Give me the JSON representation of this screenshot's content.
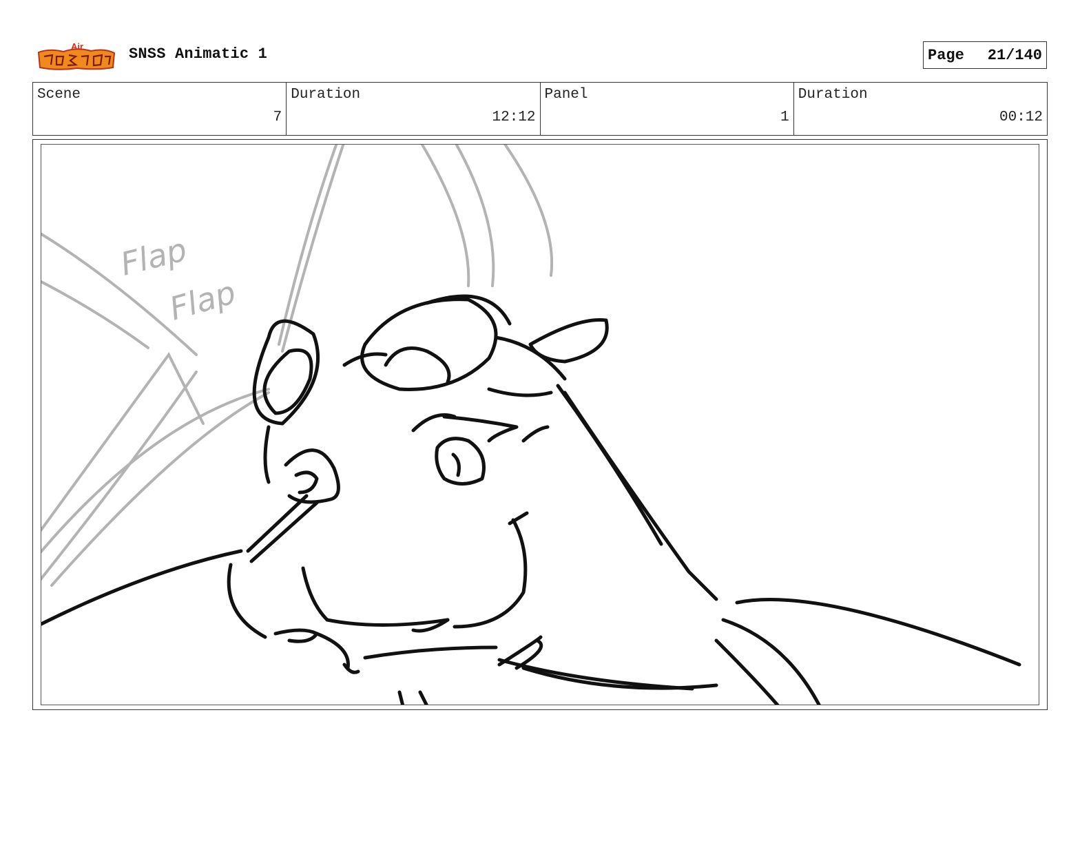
{
  "header": {
    "logo_icon": "show-logo-icon",
    "project_title": "SNSS Animatic 1",
    "page_label": "Page",
    "page_number": "21/140"
  },
  "info": {
    "scene_label": "Scene",
    "scene_value": "7",
    "scene_duration_label": "Duration",
    "scene_duration_value": "12:12",
    "panel_label": "Panel",
    "panel_value": "1",
    "panel_duration_label": "Duration",
    "panel_duration_value": "00:12"
  },
  "panel": {
    "sketch_text_1": "Flap",
    "sketch_text_2": "Flap"
  },
  "colors": {
    "ink": "#111111",
    "sketch_gray": "#b3b3b3",
    "logo_orange": "#f08a1c",
    "logo_red": "#d8301c"
  }
}
